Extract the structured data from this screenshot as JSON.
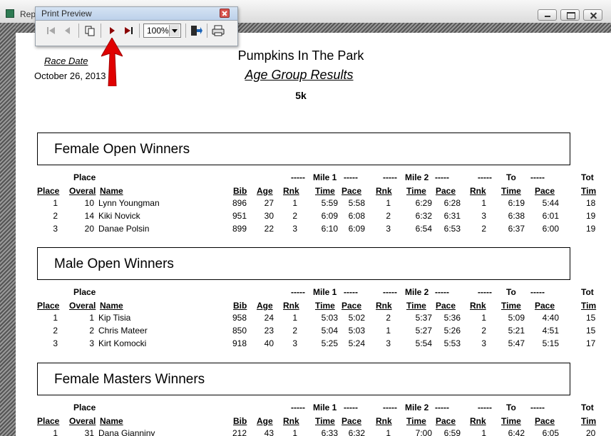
{
  "window": {
    "title": "Rep"
  },
  "print_preview": {
    "caption": "Print Preview",
    "zoom": "100%",
    "buttons": [
      "first-page",
      "previous-page",
      "multi-page",
      "next-page",
      "last-page",
      "exit",
      "print"
    ]
  },
  "report": {
    "race_date_label": "Race Date",
    "race_date": "October 26, 2013",
    "event_title": "Pumpkins In The Park",
    "subtitle": "Age Group Results",
    "distance": "5k"
  },
  "header_labels": {
    "place_top": "Place",
    "place": "Place",
    "overal": "Overal",
    "name": "Name",
    "bib": "Bib",
    "age": "Age",
    "dashes": "-----",
    "mile1": "Mile 1",
    "mile2": "Mile 2",
    "to": "To",
    "tot": "Tot",
    "rnk": "Rnk",
    "time": "Time",
    "pace": "Pace",
    "tim": "Tim"
  },
  "sections": [
    {
      "title": "Female Open Winners",
      "rows": [
        [
          "1",
          "10",
          "Lynn Youngman",
          "896",
          "27",
          "1",
          "5:59",
          "5:58",
          "1",
          "6:29",
          "6:28",
          "1",
          "6:19",
          "5:44",
          "18"
        ],
        [
          "2",
          "14",
          "Kiki Novick",
          "951",
          "30",
          "2",
          "6:09",
          "6:08",
          "2",
          "6:32",
          "6:31",
          "3",
          "6:38",
          "6:01",
          "19"
        ],
        [
          "3",
          "20",
          "Danae Polsin",
          "899",
          "22",
          "3",
          "6:10",
          "6:09",
          "3",
          "6:54",
          "6:53",
          "2",
          "6:37",
          "6:00",
          "19"
        ]
      ]
    },
    {
      "title": "Male Open Winners",
      "rows": [
        [
          "1",
          "1",
          "Kip Tisia",
          "958",
          "24",
          "1",
          "5:03",
          "5:02",
          "2",
          "5:37",
          "5:36",
          "1",
          "5:09",
          "4:40",
          "15"
        ],
        [
          "2",
          "2",
          "Chris Mateer",
          "850",
          "23",
          "2",
          "5:04",
          "5:03",
          "1",
          "5:27",
          "5:26",
          "2",
          "5:21",
          "4:51",
          "15"
        ],
        [
          "3",
          "3",
          "Kirt Komocki",
          "918",
          "40",
          "3",
          "5:25",
          "5:24",
          "3",
          "5:54",
          "5:53",
          "3",
          "5:47",
          "5:15",
          "17"
        ]
      ]
    },
    {
      "title": "Female Masters Winners",
      "rows": [
        [
          "1",
          "31",
          "Dana Gianniny",
          "212",
          "43",
          "1",
          "6:33",
          "6:32",
          "1",
          "7:00",
          "6:59",
          "1",
          "6:42",
          "6:05",
          "20"
        ]
      ]
    }
  ]
}
